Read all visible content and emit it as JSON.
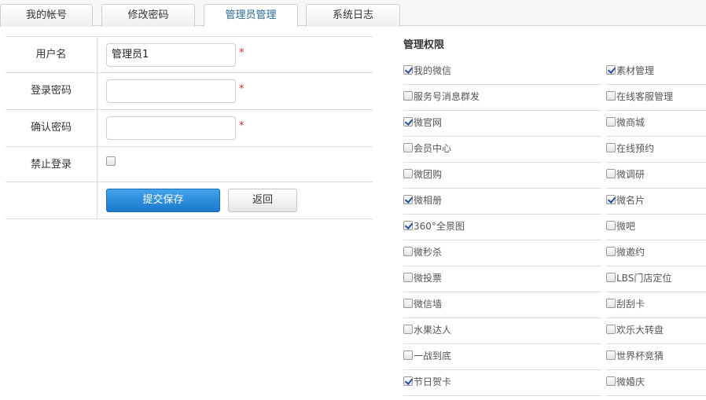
{
  "tabs": [
    {
      "label": "我的帐号",
      "active": false
    },
    {
      "label": "修改密码",
      "active": false
    },
    {
      "label": "管理员管理",
      "active": true
    },
    {
      "label": "系统日志",
      "active": false
    }
  ],
  "form": {
    "username_label": "用户名",
    "username_value": "管理员1",
    "password_label": "登录密码",
    "password_value": "",
    "confirm_label": "确认密码",
    "confirm_value": "",
    "disable_label": "禁止登录",
    "disable_checked": false,
    "required_mark": "*",
    "save_label": "提交保存",
    "back_label": "返回"
  },
  "permissions": {
    "title": "管理权限",
    "rows": [
      [
        {
          "label": "我的微信",
          "checked": true
        },
        {
          "label": "素材管理",
          "checked": true
        }
      ],
      [
        {
          "label": "服务号消息群发",
          "checked": false
        },
        {
          "label": "在线客服管理",
          "checked": false
        }
      ],
      [
        {
          "label": "微官网",
          "checked": true
        },
        {
          "label": "微商城",
          "checked": false
        }
      ],
      [
        {
          "label": "会员中心",
          "checked": false
        },
        {
          "label": "在线预约",
          "checked": false
        }
      ],
      [
        {
          "label": "微团购",
          "checked": false
        },
        {
          "label": "微调研",
          "checked": false
        }
      ],
      [
        {
          "label": "微相册",
          "checked": true
        },
        {
          "label": "微名片",
          "checked": true
        }
      ],
      [
        {
          "label": "360°全景图",
          "checked": true
        },
        {
          "label": "微吧",
          "checked": false
        }
      ],
      [
        {
          "label": "微秒杀",
          "checked": false
        },
        {
          "label": "微邀约",
          "checked": false
        }
      ],
      [
        {
          "label": "微投票",
          "checked": false
        },
        {
          "label": "LBS门店定位",
          "checked": false
        }
      ],
      [
        {
          "label": "微信墙",
          "checked": false
        },
        {
          "label": "刮刮卡",
          "checked": false
        }
      ],
      [
        {
          "label": "水果达人",
          "checked": false
        },
        {
          "label": "欢乐大转盘",
          "checked": false
        }
      ],
      [
        {
          "label": "一战到底",
          "checked": false
        },
        {
          "label": "世界杯竞猜",
          "checked": false
        }
      ],
      [
        {
          "label": "节日贺卡",
          "checked": true
        },
        {
          "label": "微婚庆",
          "checked": false
        }
      ]
    ]
  },
  "colors": {
    "accent": "#2a6a9c",
    "primary_button": "#1a79cc",
    "required": "#d42b2b"
  }
}
